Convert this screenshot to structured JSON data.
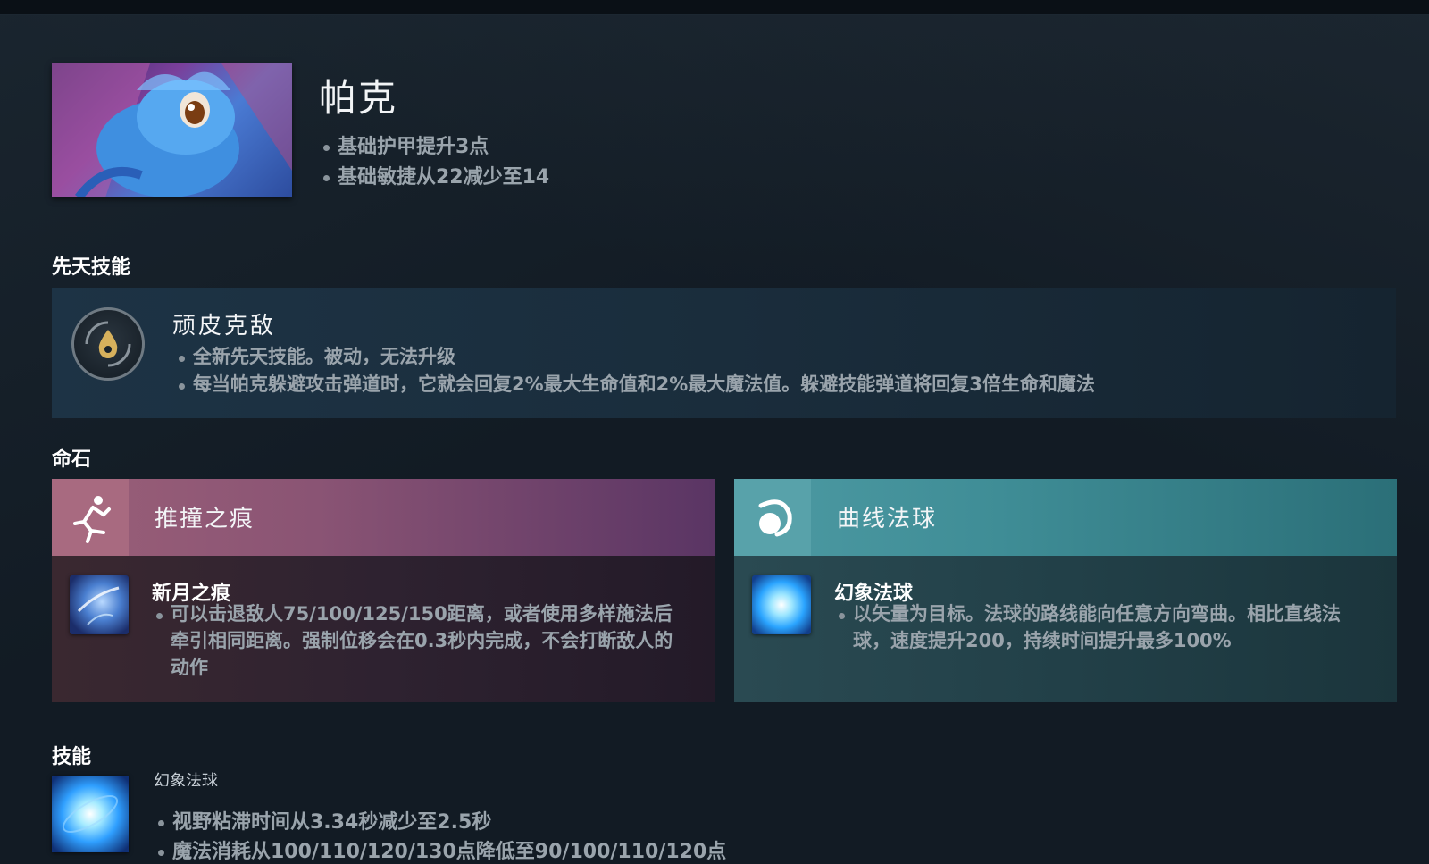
{
  "hero": {
    "name": "帕克",
    "notes": [
      "基础护甲提升3点",
      "基础敏捷从22减少至14"
    ]
  },
  "innate": {
    "section_title": "先天技能",
    "name": "顽皮克敌",
    "notes": [
      "全新先天技能。被动，无法升级",
      "每当帕克躲避攻击弹道时，它就会回复2%最大生命值和2%最大魔法值。躲避技能弹道将回复3倍生命和魔法"
    ]
  },
  "facets": {
    "section_title": "命石",
    "items": [
      {
        "title": "推撞之痕",
        "ability_name": "新月之痕",
        "notes": [
          "可以击退敌人75/100/125/150距离，或者使用多样施法后牵引相同距离。强制位移会在0.3秒内完成，不会打断敌人的动作"
        ]
      },
      {
        "title": "曲线法球",
        "ability_name": "幻象法球",
        "notes": [
          "以矢量为目标。法球的路线能向任意方向弯曲。相比直线法球，速度提升200，持续时间提升最多100%"
        ]
      }
    ]
  },
  "abilities": {
    "section_title": "技能",
    "items": [
      {
        "name": "幻象法球",
        "notes": [
          "视野粘滞时间从3.34秒减少至2.5秒",
          "魔法消耗从100/110/120/130点降低至90/100/110/120点"
        ]
      }
    ]
  },
  "colors": {
    "background": "#121b24",
    "facet_left_accent": "#9a5f78",
    "facet_right_accent": "#4d9aa3",
    "innate_panel": "#1d3345"
  }
}
